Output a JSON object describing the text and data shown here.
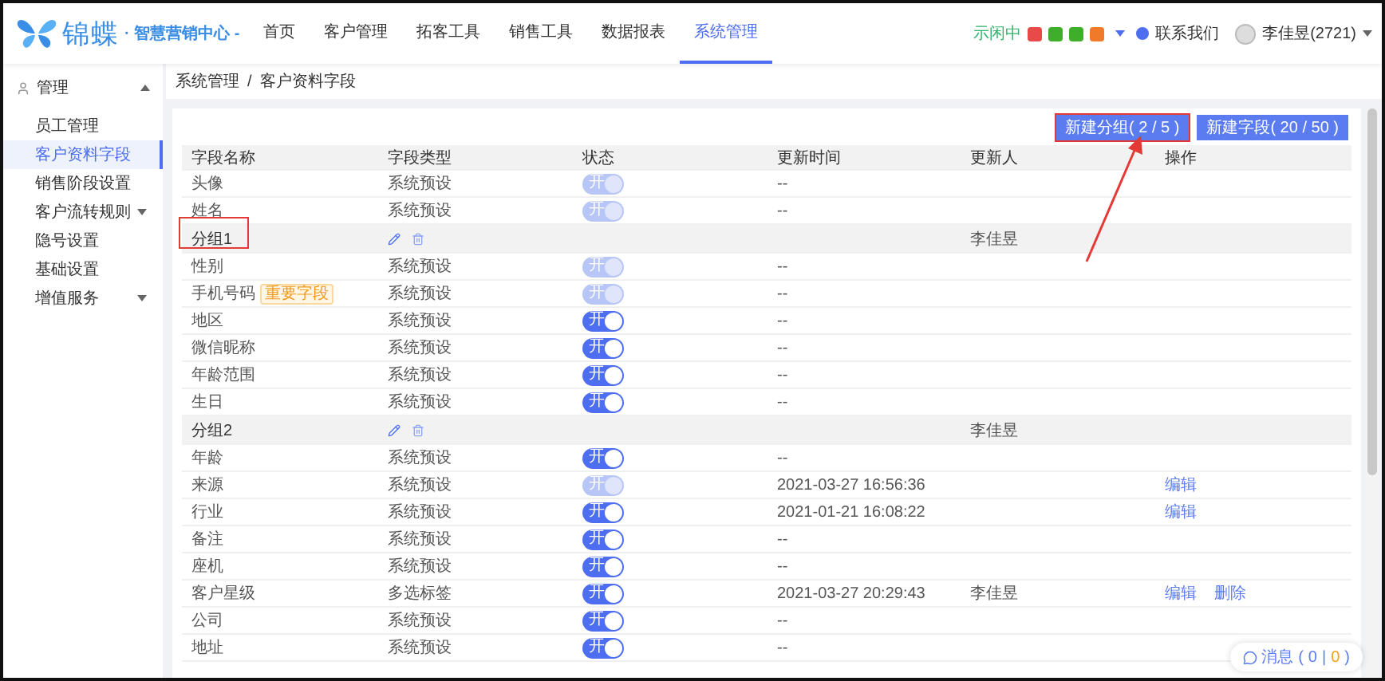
{
  "header": {
    "logo": {
      "name": "锦蝶",
      "suffix": "· 智慧营销中心 -"
    },
    "nav": [
      {
        "label": "首页",
        "selected": false
      },
      {
        "label": "客户管理",
        "selected": false
      },
      {
        "label": "拓客工具",
        "selected": false
      },
      {
        "label": "销售工具",
        "selected": false
      },
      {
        "label": "数据报表",
        "selected": false
      },
      {
        "label": "系统管理",
        "selected": true
      }
    ],
    "presence": "示闲中",
    "status_icons": [
      {
        "color": "#e84a4a"
      },
      {
        "color": "#3fae2a"
      },
      {
        "color": "#3fae2a"
      },
      {
        "color": "#f07a2a"
      }
    ],
    "contact": "联系我们",
    "user": "李佳昱(2721)"
  },
  "sidebar": {
    "items": [
      {
        "label": "管理",
        "expanded": true,
        "children": [
          {
            "label": "员工管理",
            "selected": false
          },
          {
            "label": "客户资料字段",
            "selected": true
          },
          {
            "label": "销售阶段设置",
            "selected": false
          },
          {
            "label": "客户流转规则",
            "selected": false,
            "expanded": false
          },
          {
            "label": "隐号设置",
            "selected": false
          },
          {
            "label": "基础设置",
            "selected": false
          },
          {
            "label": "增值服务",
            "selected": false,
            "expanded": false
          }
        ]
      }
    ]
  },
  "breadcrumb": [
    "系统管理",
    "/",
    "客户资料字段"
  ],
  "buttons": [
    {
      "label": "新建分组( 2 / 5 )",
      "annotated": true
    },
    {
      "label": "新建字段( 20 / 50 )",
      "annotated": false
    }
  ],
  "table": {
    "columns": [
      "字段名称",
      "字段类型",
      "状态",
      "更新时间",
      "更新人",
      "操作"
    ],
    "rows": [
      {
        "kind": "field",
        "name": "头像",
        "type": "系统预设",
        "status": {
          "label": "开",
          "on": true,
          "disabled": true
        },
        "updated": "--"
      },
      {
        "kind": "field",
        "name": "姓名",
        "type": "系统预设",
        "status": {
          "label": "开",
          "on": true,
          "disabled": true
        },
        "updated": "--"
      },
      {
        "kind": "group",
        "name": "分组1",
        "updater": "李佳昱",
        "annotated": true
      },
      {
        "kind": "field",
        "name": "性别",
        "type": "系统预设",
        "status": {
          "label": "开",
          "on": true,
          "disabled": true
        },
        "updated": "--"
      },
      {
        "kind": "field",
        "name": "手机号码",
        "tag": "重要字段",
        "type": "系统预设",
        "status": {
          "label": "开",
          "on": true,
          "disabled": true
        },
        "updated": "--"
      },
      {
        "kind": "field",
        "name": "地区",
        "type": "系统预设",
        "status": {
          "label": "开",
          "on": true,
          "disabled": false
        },
        "updated": "--"
      },
      {
        "kind": "field",
        "name": "微信昵称",
        "type": "系统预设",
        "status": {
          "label": "开",
          "on": true,
          "disabled": false
        },
        "updated": "--"
      },
      {
        "kind": "field",
        "name": "年龄范围",
        "type": "系统预设",
        "status": {
          "label": "开",
          "on": true,
          "disabled": false
        },
        "updated": "--"
      },
      {
        "kind": "field",
        "name": "生日",
        "type": "系统预设",
        "status": {
          "label": "开",
          "on": true,
          "disabled": false
        },
        "updated": "--"
      },
      {
        "kind": "group",
        "name": "分组2",
        "updater": "李佳昱",
        "annotated": false
      },
      {
        "kind": "field",
        "name": "年龄",
        "type": "系统预设",
        "status": {
          "label": "开",
          "on": true,
          "disabled": false
        },
        "updated": "--"
      },
      {
        "kind": "field",
        "name": "来源",
        "type": "系统预设",
        "status": {
          "label": "开",
          "on": true,
          "disabled": true
        },
        "updated": "2021-03-27 16:56:36",
        "actions": [
          "编辑"
        ]
      },
      {
        "kind": "field",
        "name": "行业",
        "type": "系统预设",
        "status": {
          "label": "开",
          "on": true,
          "disabled": false
        },
        "updated": "2021-01-21 16:08:22",
        "actions": [
          "编辑"
        ]
      },
      {
        "kind": "field",
        "name": "备注",
        "type": "系统预设",
        "status": {
          "label": "开",
          "on": true,
          "disabled": false
        },
        "updated": "--"
      },
      {
        "kind": "field",
        "name": "座机",
        "type": "系统预设",
        "status": {
          "label": "开",
          "on": true,
          "disabled": false
        },
        "updated": "--"
      },
      {
        "kind": "field",
        "name": "客户星级",
        "type": "多选标签",
        "status": {
          "label": "开",
          "on": true,
          "disabled": false
        },
        "updated": "2021-03-27 20:29:43",
        "updater": "李佳昱",
        "actions": [
          "编辑",
          "删除"
        ]
      },
      {
        "kind": "field",
        "name": "公司",
        "type": "系统预设",
        "status": {
          "label": "开",
          "on": true,
          "disabled": false
        },
        "updated": "--"
      },
      {
        "kind": "field",
        "name": "地址",
        "type": "系统预设",
        "status": {
          "label": "开",
          "on": true,
          "disabled": false
        },
        "updated": "--"
      }
    ]
  },
  "message_widget": {
    "label": "消息",
    "open": "(",
    "counts": [
      "0",
      "0"
    ],
    "separator": "|",
    "close": ")"
  }
}
